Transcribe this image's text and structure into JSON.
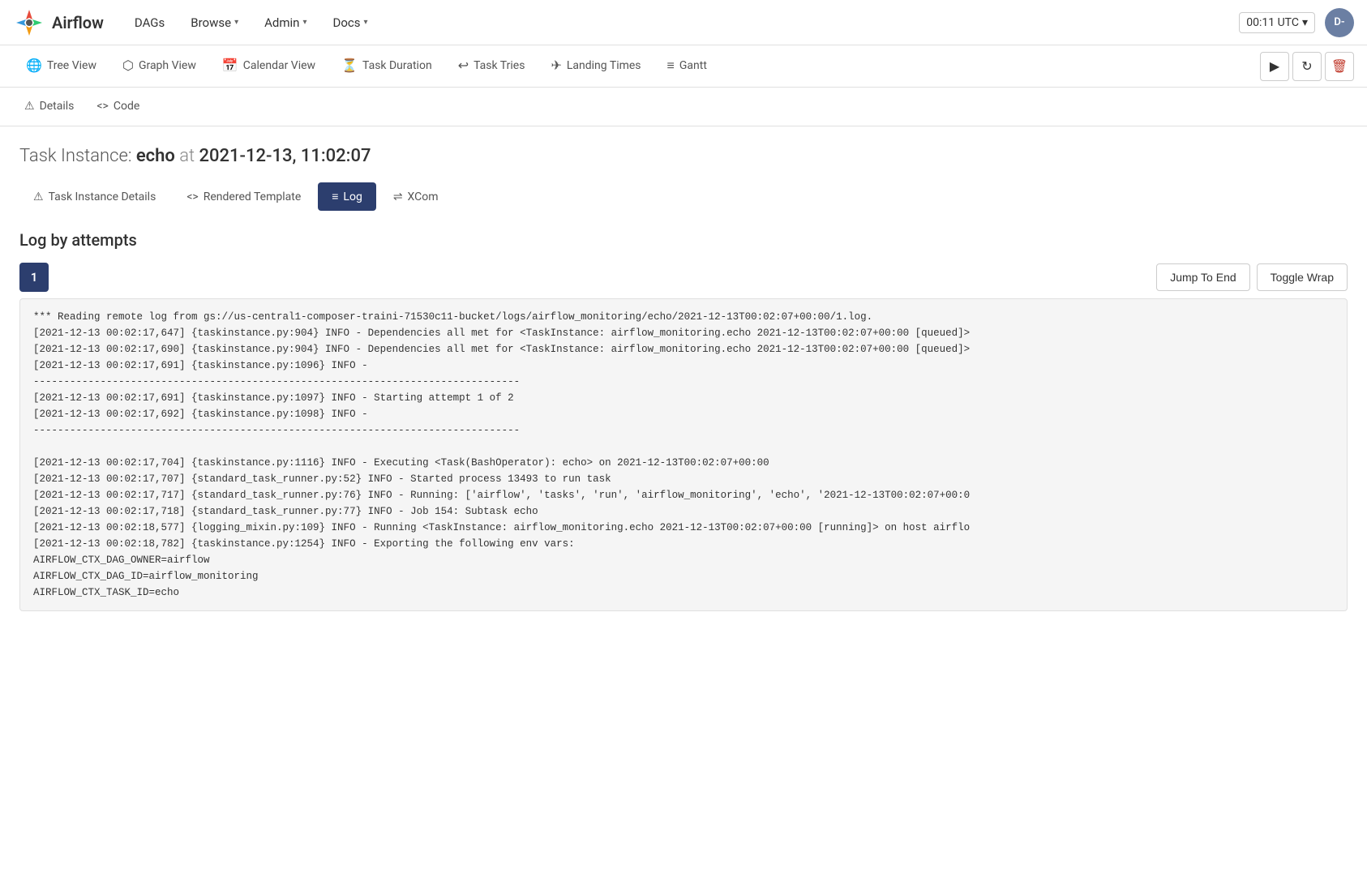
{
  "navbar": {
    "appname": "Airflow",
    "nav_items": [
      {
        "label": "DAGs",
        "has_dropdown": false
      },
      {
        "label": "Browse",
        "has_dropdown": true
      },
      {
        "label": "Admin",
        "has_dropdown": true
      },
      {
        "label": "Docs",
        "has_dropdown": true
      }
    ],
    "utc_time": "00:11 UTC",
    "user_initials": "D-"
  },
  "top_tabs": [
    {
      "label": "Tree View",
      "icon": "🌐",
      "active": false
    },
    {
      "label": "Graph View",
      "icon": "⬡",
      "active": false
    },
    {
      "label": "Calendar View",
      "icon": "📅",
      "active": false
    },
    {
      "label": "Task Duration",
      "icon": "⏳",
      "active": false
    },
    {
      "label": "Task Tries",
      "icon": "↩",
      "active": false
    },
    {
      "label": "Landing Times",
      "icon": "✈",
      "active": false
    },
    {
      "label": "Gantt",
      "icon": "≡",
      "active": false
    }
  ],
  "toolbar_buttons": {
    "play": "▶",
    "refresh": "↻",
    "delete": "🗑"
  },
  "second_tabs": [
    {
      "label": "Details",
      "icon": "⚠"
    },
    {
      "label": "Code",
      "icon": "<>"
    }
  ],
  "task_instance": {
    "prefix": "Task Instance:",
    "task_name": "echo",
    "at_word": "at",
    "datetime": "2021-12-13, 11:02:07"
  },
  "subtabs": [
    {
      "label": "Task Instance Details",
      "icon": "⚠",
      "active": false
    },
    {
      "label": "Rendered Template",
      "icon": "<>",
      "active": false
    },
    {
      "label": "Log",
      "icon": "≡",
      "active": true
    },
    {
      "label": "XCom",
      "icon": "⇌",
      "active": false
    }
  ],
  "log_section": {
    "title": "Log by attempts",
    "attempt_number": "1",
    "jump_to_end_label": "Jump To End",
    "toggle_wrap_label": "Toggle Wrap",
    "log_lines": [
      "*** Reading remote log from gs://us-central1-composer-traini-71530c11-bucket/logs/airflow_monitoring/echo/2021-12-13T00:02:07+00:00/1.log.",
      "[2021-12-13 00:02:17,647] {taskinstance.py:904} INFO - Dependencies all met for <TaskInstance: airflow_monitoring.echo 2021-12-13T00:02:07+00:00 [queued]>",
      "[2021-12-13 00:02:17,690] {taskinstance.py:904} INFO - Dependencies all met for <TaskInstance: airflow_monitoring.echo 2021-12-13T00:02:07+00:00 [queued]>",
      "[2021-12-13 00:02:17,691] {taskinstance.py:1096} INFO -",
      "--------------------------------------------------------------------------------",
      "[2021-12-13 00:02:17,691] {taskinstance.py:1097} INFO - Starting attempt 1 of 2",
      "[2021-12-13 00:02:17,692] {taskinstance.py:1098} INFO -",
      "--------------------------------------------------------------------------------",
      "",
      "[2021-12-13 00:02:17,704] {taskinstance.py:1116} INFO - Executing <Task(BashOperator): echo> on 2021-12-13T00:02:07+00:00",
      "[2021-12-13 00:02:17,707] {standard_task_runner.py:52} INFO - Started process 13493 to run task",
      "[2021-12-13 00:02:17,717] {standard_task_runner.py:76} INFO - Running: ['airflow', 'tasks', 'run', 'airflow_monitoring', 'echo', '2021-12-13T00:02:07+00:0",
      "[2021-12-13 00:02:17,718] {standard_task_runner.py:77} INFO - Job 154: Subtask echo",
      "[2021-12-13 00:02:18,577] {logging_mixin.py:109} INFO - Running <TaskInstance: airflow_monitoring.echo 2021-12-13T00:02:07+00:00 [running]> on host airflo",
      "[2021-12-13 00:02:18,782] {taskinstance.py:1254} INFO - Exporting the following env vars:",
      "AIRFLOW_CTX_DAG_OWNER=airflow",
      "AIRFLOW_CTX_DAG_ID=airflow_monitoring",
      "AIRFLOW_CTX_TASK_ID=echo"
    ]
  }
}
